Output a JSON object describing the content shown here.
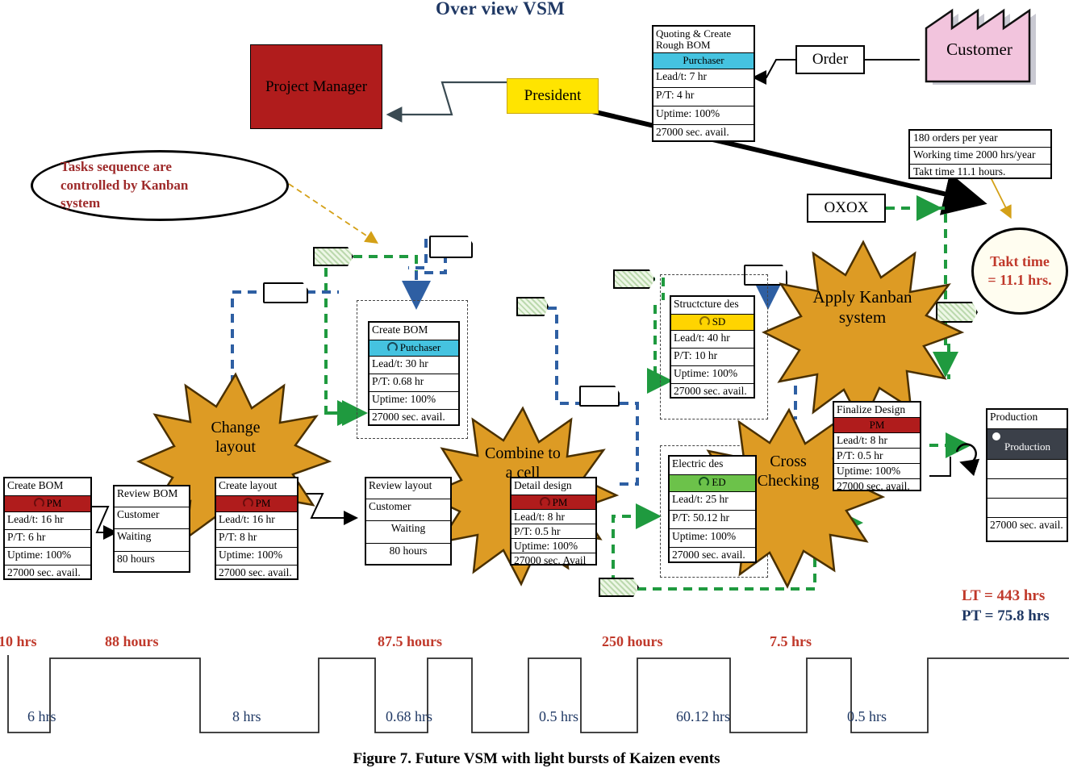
{
  "title": "Over view VSM",
  "caption": "Figure 7. Future VSM with light bursts of Kaizen events",
  "colors": {
    "title": "#1f3864",
    "kaizen_burst": "#dd9b24",
    "project_manager": "#b01c1c",
    "president": "#ffe400",
    "customer": "#f2c4dd",
    "role_purchaser": "#45c3e0",
    "role_pm": "#b01c1c",
    "role_sd": "#ffd400",
    "role_ed": "#6cc24a",
    "role_production": "#3b4049",
    "kanban_flow": "#1f9a3f",
    "info_flow": "#2e5fa3",
    "annotation_red": "#9e2a2a",
    "timeline_wait": "#c0392b",
    "timeline_process": "#1f3864"
  },
  "entities": {
    "project_manager": "Project Manager",
    "president": "President",
    "customer": "Customer",
    "order": "Order",
    "oxox": "OXOX"
  },
  "quoting_box": {
    "name": "Quoting & Create Rough BOM",
    "role": "Purchaser",
    "rows": [
      "Lead/t: 7 hr",
      "P/T: 4 hr",
      "Uptime: 100%",
      "27000 sec. avail."
    ]
  },
  "takt_info": {
    "rows": [
      "180 orders per year",
      "Working time 2000 hrs/year",
      "Takt time    11.1 hours."
    ]
  },
  "takt_circle": "Takt time\n= 11.1 hrs.",
  "takt_circle_line1": "Takt time",
  "takt_circle_line2": "= 11.1 hrs.",
  "kanban_note": "Tasks sequence are controlled by Kanban system",
  "kanban_note_lines": [
    "Tasks sequence are",
    "controlled by Kanban",
    "system"
  ],
  "processes": [
    {
      "id": "create-bom-pm",
      "name": "Create BOM",
      "role": "PM",
      "role_color": "red",
      "rows": [
        "Lead/t: 16 hr",
        "P/T: 6 hr",
        "Uptime: 100%",
        "27000 sec. avail."
      ]
    },
    {
      "id": "review-bom",
      "name": "Review BOM",
      "role": "Customer",
      "role_color": "none",
      "rows": [
        "Waiting",
        "80 hours"
      ]
    },
    {
      "id": "create-layout",
      "name": "Create layout",
      "role": "PM",
      "role_color": "red",
      "rows": [
        "Lead/t: 16 hr",
        "P/T: 8 hr",
        "Uptime: 100%",
        "27000 sec. avail."
      ]
    },
    {
      "id": "review-layout",
      "name": "Review layout",
      "role": "Customer",
      "role_color": "none",
      "rows": [
        "Waiting",
        "80 hours"
      ]
    },
    {
      "id": "create-bom-purchaser",
      "name": "Create BOM",
      "role": "Putchaser",
      "role_color": "cyan",
      "rows": [
        "Lead/t: 30 hr",
        "P/T: 0.68 hr",
        "Uptime: 100%",
        "27000 sec. avail."
      ]
    },
    {
      "id": "detail-design",
      "name": "Detail design",
      "role": "PM",
      "role_color": "red",
      "rows": [
        "Lead/t: 8 hr",
        "P/T: 0.5 hr",
        "Uptime: 100%",
        "27000 sec. Avail"
      ]
    },
    {
      "id": "structure-design",
      "name": "Structcture des",
      "role": "SD",
      "role_color": "yellow",
      "rows": [
        "Lead/t: 40 hr",
        "P/T: 10 hr",
        "Uptime: 100%",
        "27000 sec. avail."
      ]
    },
    {
      "id": "electric-design",
      "name": "Electric des",
      "role": "ED",
      "role_color": "green",
      "rows": [
        "Lead/t: 25 hr",
        "P/T: 50.12 hr",
        "Uptime: 100%",
        "27000 sec. avail."
      ]
    },
    {
      "id": "finalize-design",
      "name": "Finalize Design",
      "role": "PM",
      "role_color": "red",
      "rows": [
        "Lead/t: 8 hr",
        "P/T: 0.5 hr",
        "Uptime: 100%",
        "27000 sec. avail."
      ]
    },
    {
      "id": "production",
      "name": "Production",
      "role": "Production",
      "role_color": "dark",
      "rows": [
        "",
        "",
        "",
        "27000 sec. avail."
      ]
    }
  ],
  "kaizen_bursts": [
    {
      "id": "change-layout",
      "line1": "Change",
      "line2": "layout"
    },
    {
      "id": "combine-to-cell",
      "line1": "Combine to",
      "line2": "a cell"
    },
    {
      "id": "apply-kanban",
      "line1": "Apply Kanban",
      "line2": "system"
    },
    {
      "id": "cross-checking",
      "line1": "Cross",
      "line2": "Checking"
    }
  ],
  "timeline": {
    "wait_labels": [
      "10 hrs",
      "88 hours",
      "87.5 hours",
      "250 hours",
      "7.5 hrs"
    ],
    "process_labels": [
      "6 hrs",
      "8 hrs",
      "0.68 hrs",
      "0.5 hrs",
      "60.12 hrs",
      "0.5 hrs"
    ]
  },
  "summary": {
    "lead_time": "LT = 443 hrs",
    "process_time": "PT = 75.8 hrs"
  }
}
